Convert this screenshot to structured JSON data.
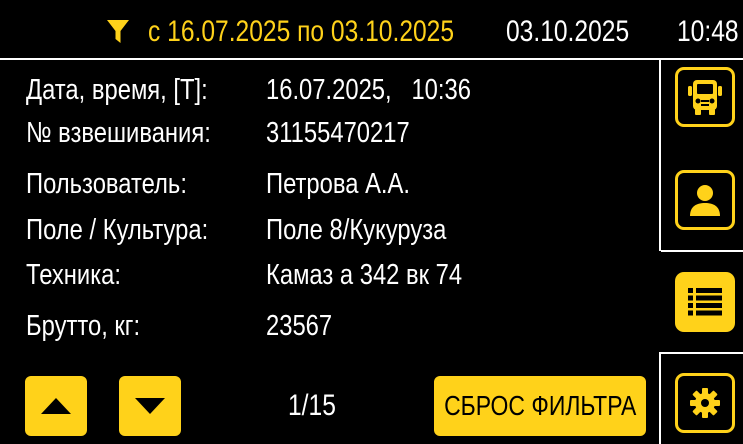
{
  "header": {
    "filter_range": "с 16.07.2025 по 03.10.2025",
    "current_date": "03.10.2025",
    "current_time": "10:48"
  },
  "record": {
    "fields": [
      {
        "label": "Дата, время, [Т]:",
        "value": "16.07.2025,   10:36"
      },
      {
        "label": "№ взвешивания:",
        "value": "31155470217"
      },
      {
        "label": "Пользователь:",
        "value": "Петрова А.А."
      },
      {
        "label": "Поле / Культура:",
        "value": "Поле 8/Кукуруза"
      },
      {
        "label": "Техника:",
        "value": "Камаз а 342 вк 74"
      },
      {
        "label": "Брутто, кг:",
        "value": "23567"
      }
    ]
  },
  "navigation": {
    "page_indicator": "1/15",
    "reset_filter_label": "СБРОС ФИЛЬТРА"
  },
  "sidebar": {
    "items": [
      {
        "icon": "truck-icon",
        "active": false
      },
      {
        "icon": "user-icon",
        "active": false
      },
      {
        "icon": "list-icon",
        "active": true
      },
      {
        "icon": "gear-icon",
        "active": false
      }
    ]
  },
  "colors": {
    "accent": "#ffd21a",
    "background": "#000000",
    "text": "#ffffff"
  }
}
